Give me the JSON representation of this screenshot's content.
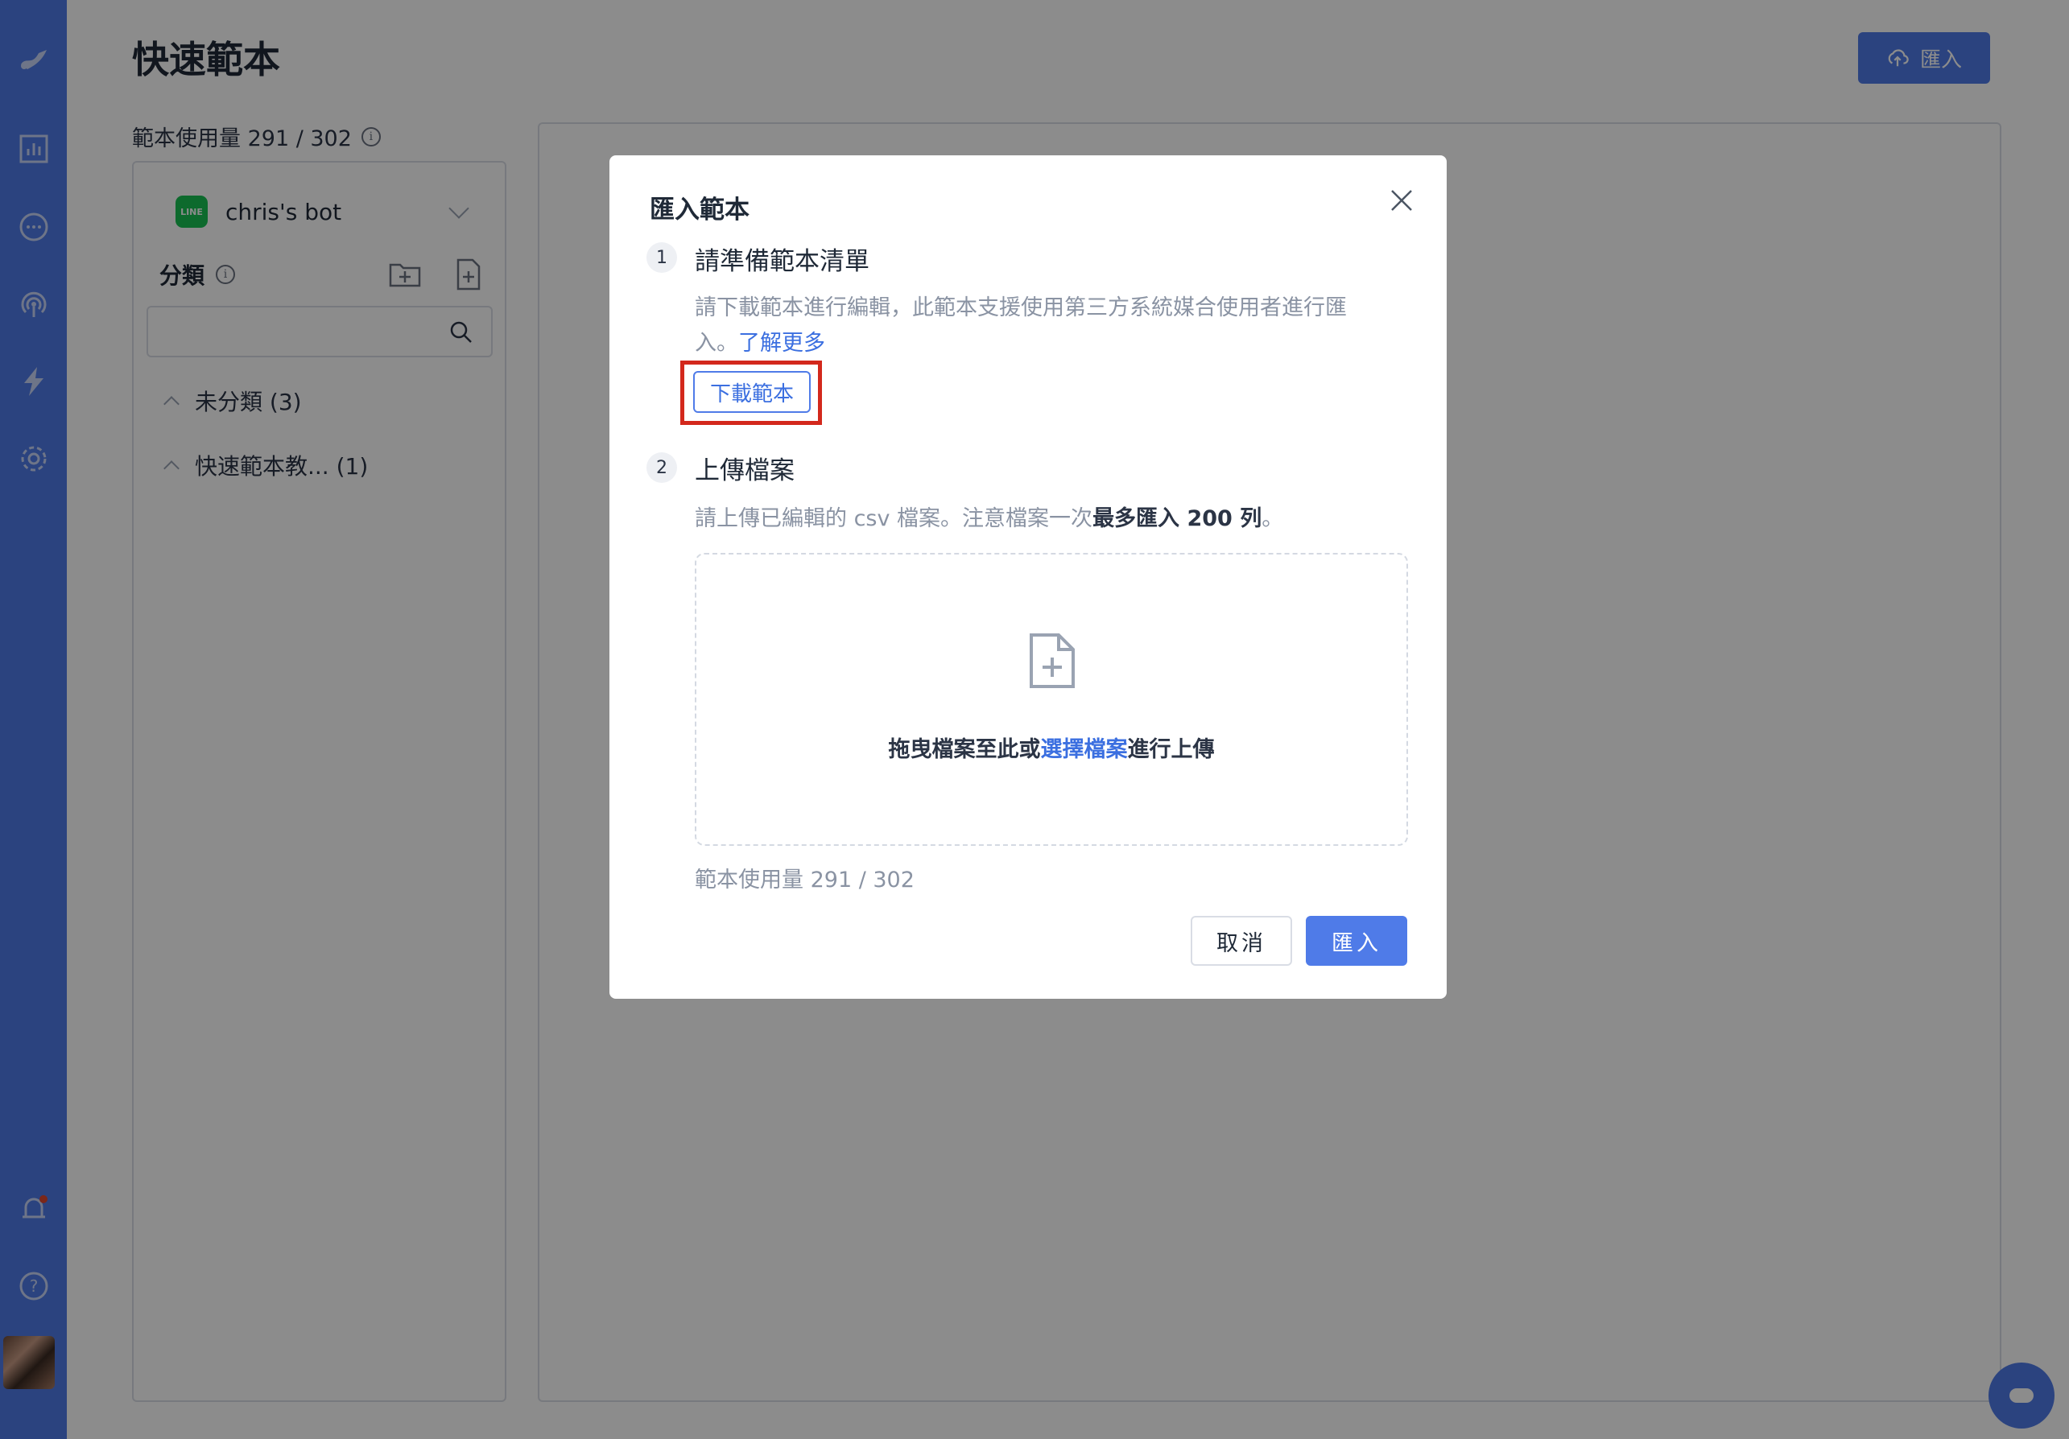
{
  "page": {
    "title": "快速範本",
    "top_import_label": "匯入",
    "usage_text": "範本使用量 291 / 302"
  },
  "sidebar": {
    "bot_name": "chris's bot",
    "bot_logo_text": "LINE",
    "category_label": "分類",
    "search_placeholder": "",
    "tree": [
      {
        "label": "未分類",
        "count": "(3)"
      },
      {
        "label": "快速範本教...",
        "count": "(1)"
      }
    ]
  },
  "modal": {
    "title": "匯入範本",
    "step1": {
      "number": "1",
      "title": "請準備範本清單",
      "desc_line1": "請下載範本進行編輯，此範本支援使用第三方系統媒合使用者進行匯",
      "desc_line2": "入。",
      "learn_more": "了解更多",
      "download_label": "下載範本"
    },
    "step2": {
      "number": "2",
      "title": "上傳檔案",
      "desc_prefix": "請上傳已編輯的 csv 檔案。注意檔案一次",
      "desc_strong": "最多匯入 200 列",
      "desc_suffix": "。",
      "drop_prefix": "拖曳檔案至此或",
      "drop_link": "選擇檔案",
      "drop_suffix": "進行上傳"
    },
    "usage_text": "範本使用量 291 / 302",
    "cancel_label": "取消",
    "import_label": "匯入"
  },
  "icons": {
    "rail": [
      "logo-icon",
      "chart-icon",
      "chat-icon",
      "broadcast-icon",
      "lightning-icon",
      "gear-icon",
      "bell-icon",
      "help-icon"
    ],
    "accent": "#4f7be8",
    "highlight": "#d3281c"
  }
}
